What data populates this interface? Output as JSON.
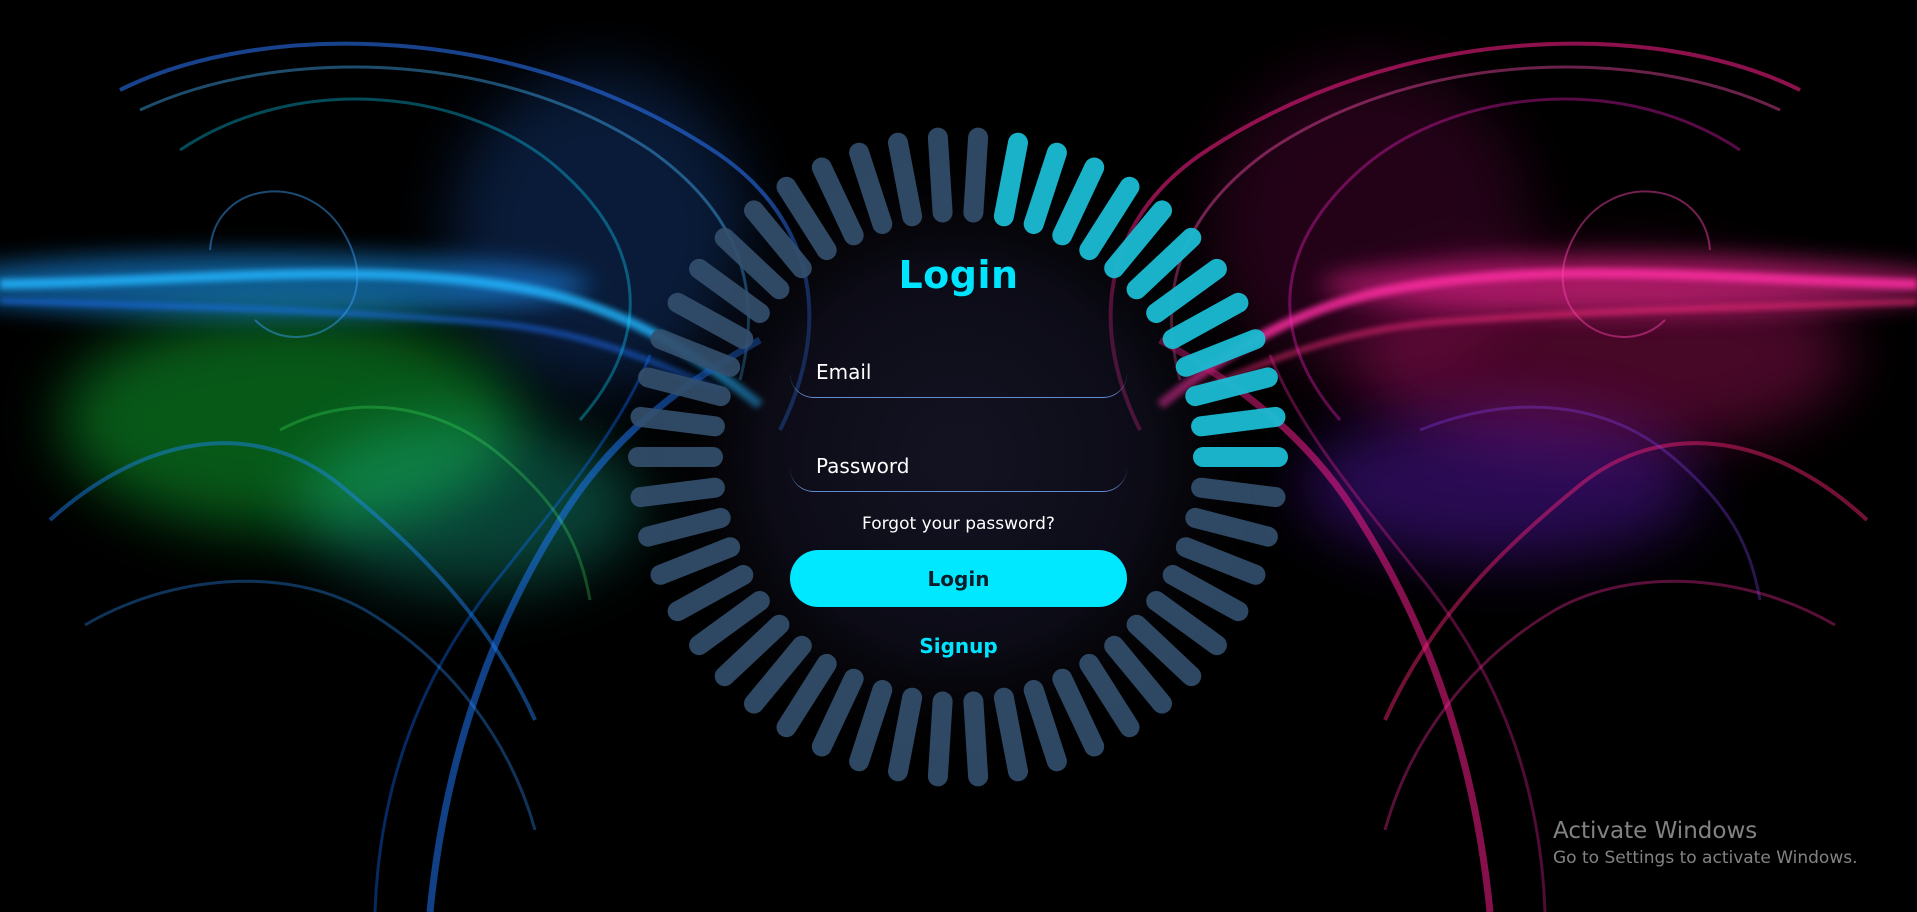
{
  "login": {
    "title": "Login",
    "email_placeholder": "Email",
    "password_placeholder": "Password",
    "forgot_link": "Forgot your password?",
    "submit_label": "Login",
    "signup_link": "Signup"
  },
  "watermark": {
    "title": "Activate Windows",
    "subtitle": "Go to Settings to activate Windows."
  },
  "loader": {
    "segment_count": 50,
    "highlighted_segments": 12,
    "active_color": "#1bbcd3",
    "idle_color": "#34506e"
  },
  "colors": {
    "accent": "#00e5ff",
    "background": "#000000",
    "left_glow": "#1ca5ff",
    "right_glow": "#ff1fa0"
  }
}
